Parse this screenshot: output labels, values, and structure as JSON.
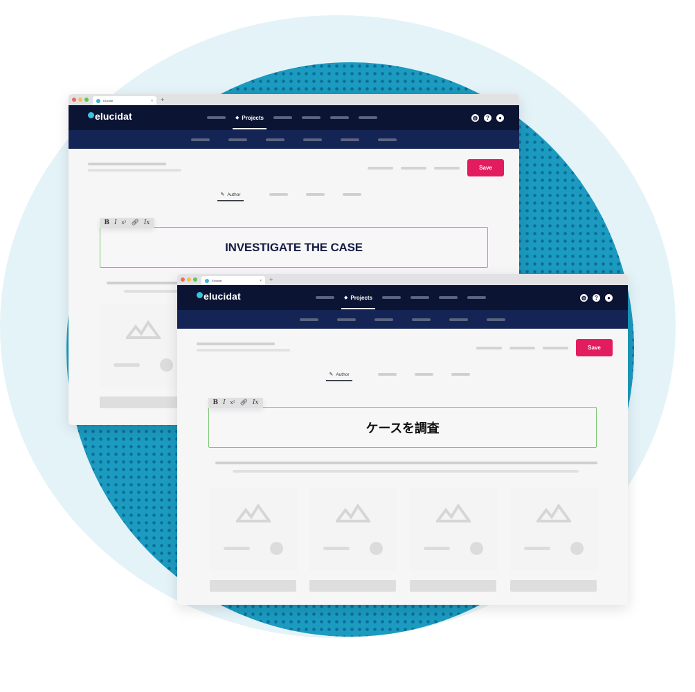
{
  "colors": {
    "accent": "#e31c5f",
    "nav_primary": "#0c1434",
    "nav_secondary": "#142454",
    "border_active": "#78c26f",
    "background_circle": "#e4f3f8",
    "dot_pattern": "#1a9bbf"
  },
  "windows": [
    {
      "tab": {
        "title": "Elucidat",
        "close": "×",
        "new_tab": "+"
      },
      "nav": {
        "logo": "elucidat",
        "active_item": {
          "icon": "layers-icon",
          "label": "Projects"
        },
        "icons": [
          {
            "name": "globe-icon",
            "glyph": "◍"
          },
          {
            "name": "help-icon",
            "glyph": "?"
          },
          {
            "name": "user-icon",
            "glyph": "●"
          }
        ]
      },
      "toolbar": {
        "save_label": "Save"
      },
      "tabs": {
        "active_label": "Author"
      },
      "editor": {
        "format_buttons": [
          "B",
          "I",
          "x²",
          "🔗",
          "Ix"
        ],
        "heading": "INVESTIGATE THE CASE"
      }
    },
    {
      "tab": {
        "title": "Elucidat",
        "close": "×",
        "new_tab": "+"
      },
      "nav": {
        "logo": "elucidat",
        "active_item": {
          "icon": "layers-icon",
          "label": "Projects"
        },
        "icons": [
          {
            "name": "globe-icon",
            "glyph": "◍"
          },
          {
            "name": "help-icon",
            "glyph": "?"
          },
          {
            "name": "user-icon",
            "glyph": "●"
          }
        ]
      },
      "toolbar": {
        "save_label": "Save"
      },
      "tabs": {
        "active_label": "Author"
      },
      "editor": {
        "format_buttons": [
          "B",
          "I",
          "x²",
          "🔗",
          "Ix"
        ],
        "heading": "ケースを調査"
      }
    }
  ]
}
